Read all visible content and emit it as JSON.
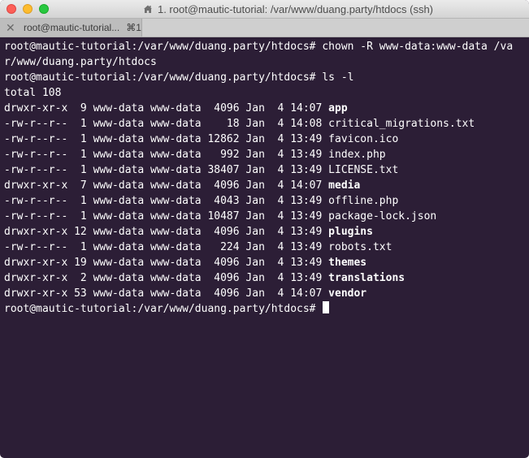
{
  "window": {
    "title": "1. root@mautic-tutorial: /var/www/duang.party/htdocs (ssh)"
  },
  "tab": {
    "label": "root@mautic-tutorial...",
    "shortcut": "⌘1",
    "close_glyph": "✕"
  },
  "terminal": {
    "prompt": "root@mautic-tutorial:/var/www/duang.party/htdocs# ",
    "cmd1_line1": "chown -R www-data:www-data /va",
    "cmd1_line2": "r/www/duang.party/htdocs",
    "cmd2": "ls -l",
    "total": "total 108",
    "entries": [
      {
        "prefix": "drwxr-xr-x  9 www-data www-data  4096 Jan  4 14:07 ",
        "name": "app",
        "is_dir": true
      },
      {
        "prefix": "-rw-r--r--  1 www-data www-data    18 Jan  4 14:08 ",
        "name": "critical_migrations.txt",
        "is_dir": false
      },
      {
        "prefix": "-rw-r--r--  1 www-data www-data 12862 Jan  4 13:49 ",
        "name": "favicon.ico",
        "is_dir": false
      },
      {
        "prefix": "-rw-r--r--  1 www-data www-data   992 Jan  4 13:49 ",
        "name": "index.php",
        "is_dir": false
      },
      {
        "prefix": "-rw-r--r--  1 www-data www-data 38407 Jan  4 13:49 ",
        "name": "LICENSE.txt",
        "is_dir": false
      },
      {
        "prefix": "drwxr-xr-x  7 www-data www-data  4096 Jan  4 14:07 ",
        "name": "media",
        "is_dir": true
      },
      {
        "prefix": "-rw-r--r--  1 www-data www-data  4043 Jan  4 13:49 ",
        "name": "offline.php",
        "is_dir": false
      },
      {
        "prefix": "-rw-r--r--  1 www-data www-data 10487 Jan  4 13:49 ",
        "name": "package-lock.json",
        "is_dir": false
      },
      {
        "prefix": "drwxr-xr-x 12 www-data www-data  4096 Jan  4 13:49 ",
        "name": "plugins",
        "is_dir": true
      },
      {
        "prefix": "-rw-r--r--  1 www-data www-data   224 Jan  4 13:49 ",
        "name": "robots.txt",
        "is_dir": false
      },
      {
        "prefix": "drwxr-xr-x 19 www-data www-data  4096 Jan  4 13:49 ",
        "name": "themes",
        "is_dir": true
      },
      {
        "prefix": "drwxr-xr-x  2 www-data www-data  4096 Jan  4 13:49 ",
        "name": "translations",
        "is_dir": true
      },
      {
        "prefix": "drwxr-xr-x 53 www-data www-data  4096 Jan  4 14:07 ",
        "name": "vendor",
        "is_dir": true
      }
    ]
  },
  "colors": {
    "background": "#2c1e36",
    "foreground": "#ffffff"
  }
}
